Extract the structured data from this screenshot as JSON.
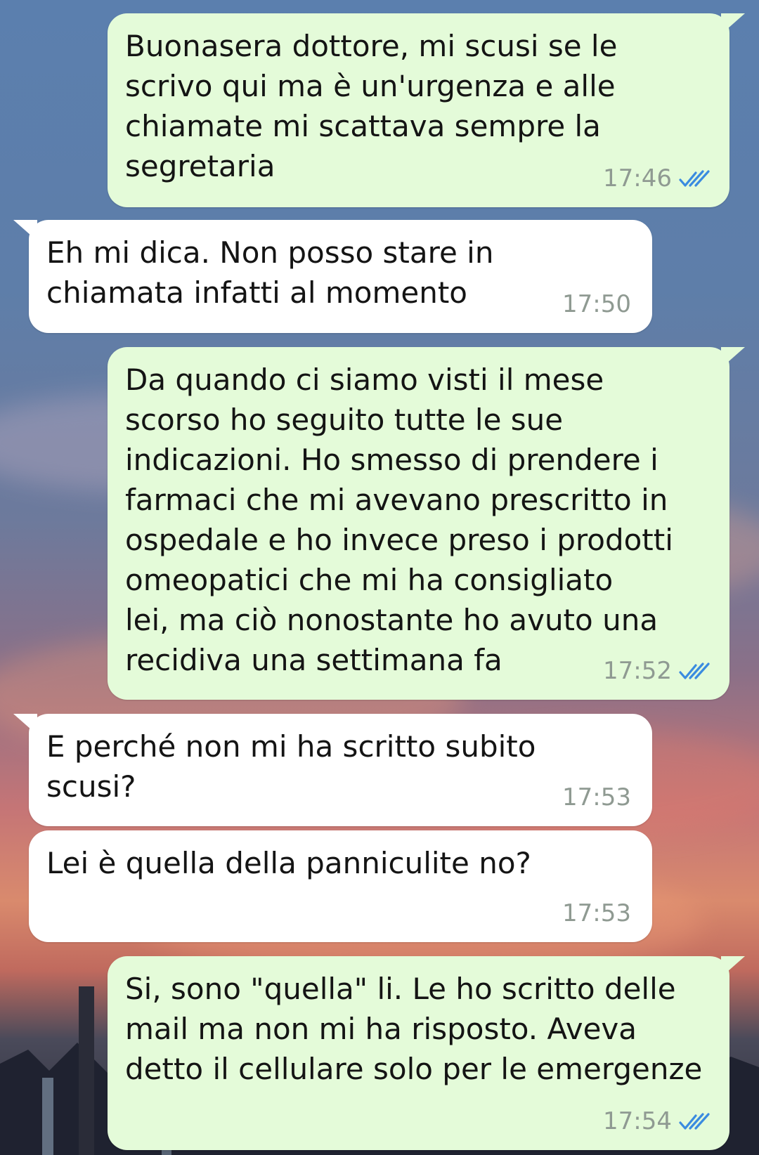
{
  "conversation": {
    "messages": [
      {
        "direction": "outgoing",
        "text": "Buonasera dottore, mi scusi se le\nscrivo qui ma è un'urgenza e alle\nchiamate mi scattava sempre la\nsegretaria",
        "time": "17:46",
        "status_icon": "double-check-read-icon"
      },
      {
        "direction": "incoming",
        "text": "Eh mi dica. Non posso stare in\nchiamata infatti al momento",
        "time": "17:50"
      },
      {
        "direction": "outgoing",
        "text": "Da quando ci siamo visti il mese\nscorso ho seguito tutte le sue\nindicazioni. Ho smesso di prendere i\nfarmaci che mi avevano prescritto in\nospedale e ho invece preso i prodotti\nomeopatici che mi ha consigliato\nlei, ma ciò nonostante ho avuto una\nrecidiva una settimana fa",
        "time": "17:52",
        "status_icon": "double-check-read-icon"
      },
      {
        "direction": "incoming",
        "text": "E perché non mi ha scritto subito\nscusi?",
        "time": "17:53"
      },
      {
        "direction": "incoming",
        "text": "Lei è quella della panniculite no?",
        "time": "17:53"
      },
      {
        "direction": "outgoing",
        "text": "Si, sono \"quella\" li. Le ho scritto delle\nmail ma non mi ha risposto. Aveva\ndetto il cellulare solo per le emergenze",
        "time": "17:54",
        "status_icon": "double-check-read-icon"
      }
    ]
  },
  "colors": {
    "outgoing_bubble": "#e4fbd9",
    "incoming_bubble": "#ffffff",
    "read_ticks": "#3a8be0",
    "timestamp": "#8f9a92"
  }
}
